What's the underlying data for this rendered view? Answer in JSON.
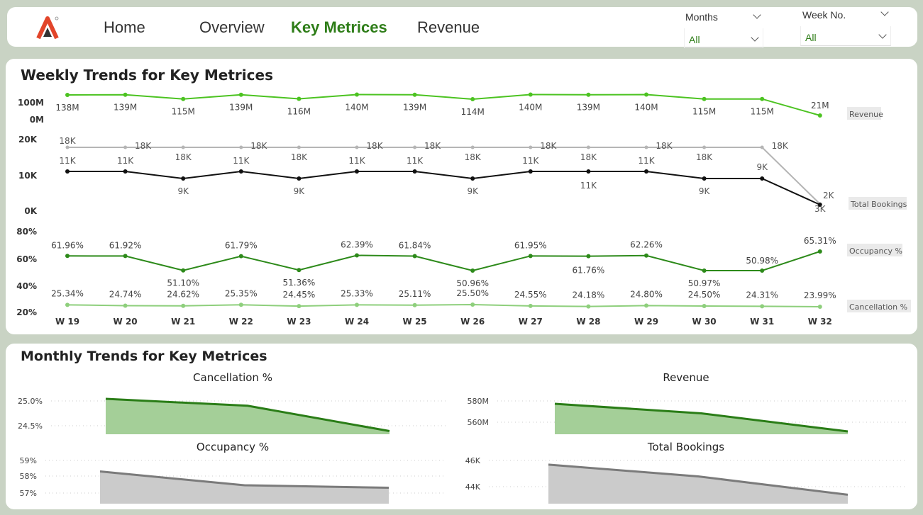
{
  "nav": {
    "items": [
      {
        "label": "Home",
        "active": false
      },
      {
        "label": "Overview",
        "active": false
      },
      {
        "label": "Key Metrices",
        "active": true
      },
      {
        "label": "Revenue",
        "active": false
      }
    ]
  },
  "filters": {
    "months": {
      "label": "Months",
      "value": "All"
    },
    "week": {
      "label": "Week No.",
      "value": "All"
    }
  },
  "weekly": {
    "title": "Weekly Trends for Key Metrices",
    "weeks": [
      "W 19",
      "W 20",
      "W 21",
      "W 22",
      "W 23",
      "W 24",
      "W 25",
      "W 26",
      "W 27",
      "W 28",
      "W 29",
      "W 30",
      "W 31",
      "W 32"
    ],
    "revenue_ticks": [
      "100M",
      "0M"
    ],
    "bookings_ticks": [
      "20K",
      "10K",
      "0K"
    ],
    "pct_ticks": [
      "80%",
      "60%",
      "40%",
      "20%"
    ]
  },
  "monthly": {
    "title": "Monthly Trends for Key Metrices"
  },
  "colors": {
    "accent": "#2e7d18",
    "revenue_line": "#4cc321",
    "occupancy_line": "#2d8a1a",
    "cancellation_line": "#8ecf7c",
    "grey_line": "#b5b5b5",
    "black_line": "#111111"
  },
  "chart_data": [
    {
      "type": "line",
      "name": "weekly-revenue",
      "x": [
        "W 19",
        "W 20",
        "W 21",
        "W 22",
        "W 23",
        "W 24",
        "W 25",
        "W 26",
        "W 27",
        "W 28",
        "W 29",
        "W 30",
        "W 31",
        "W 32"
      ],
      "series": [
        {
          "name": "Revenue",
          "values": [
            138,
            139,
            115,
            139,
            116,
            140,
            139,
            114,
            140,
            139,
            140,
            115,
            115,
            21
          ],
          "labels": [
            "138M",
            "139M",
            "115M",
            "139M",
            "116M",
            "140M",
            "139M",
            "114M",
            "140M",
            "139M",
            "140M",
            "115M",
            "115M",
            "21M"
          ]
        }
      ],
      "yticks": [
        "100M",
        "0M"
      ]
    },
    {
      "type": "line",
      "name": "weekly-bookings",
      "x": [
        "W 19",
        "W 20",
        "W 21",
        "W 22",
        "W 23",
        "W 24",
        "W 25",
        "W 26",
        "W 27",
        "W 28",
        "W 29",
        "W 30",
        "W 31",
        "W 32"
      ],
      "series": [
        {
          "values": [
            18,
            18,
            18,
            18,
            18,
            18,
            18,
            18,
            18,
            18,
            18,
            18,
            18,
            2
          ],
          "labels": [
            "18K",
            "18K",
            "18K",
            "18K",
            "18K",
            "18K",
            "18K",
            "18K",
            "18K",
            "18K",
            "18K",
            "18K",
            "18K",
            "2K"
          ]
        },
        {
          "values": [
            11,
            11,
            9,
            11,
            9,
            11,
            11,
            9,
            11,
            11,
            11,
            9,
            9,
            3
          ],
          "labels": [
            "11K",
            "11K",
            "9K",
            "11K",
            "9K",
            "11K",
            "11K",
            "9K",
            "11K",
            "11K",
            "11K",
            "9K",
            "9K",
            "3K"
          ]
        }
      ],
      "legend": "Total Bookings",
      "yticks": [
        "20K",
        "10K",
        "0K"
      ],
      "ylim": [
        0,
        20
      ]
    },
    {
      "type": "line",
      "name": "weekly-percent",
      "x": [
        "W 19",
        "W 20",
        "W 21",
        "W 22",
        "W 23",
        "W 24",
        "W 25",
        "W 26",
        "W 27",
        "W 28",
        "W 29",
        "W 30",
        "W 31",
        "W 32"
      ],
      "series": [
        {
          "name": "Occupancy %",
          "values": [
            61.96,
            61.92,
            51.1,
            61.79,
            51.36,
            62.39,
            61.84,
            50.96,
            61.95,
            61.76,
            62.26,
            50.97,
            50.98,
            65.31
          ],
          "labels": [
            "61.96%",
            "61.92%",
            "51.10%",
            "61.79%",
            "51.36%",
            "62.39%",
            "61.84%",
            "50.96%",
            "61.95%",
            "61.76%",
            "62.26%",
            "50.97%",
            "50.98%",
            "65.31%"
          ]
        },
        {
          "name": "Cancellation %",
          "values": [
            25.34,
            24.74,
            24.62,
            25.35,
            24.45,
            25.33,
            25.11,
            25.5,
            24.55,
            24.18,
            24.8,
            24.5,
            24.31,
            23.99
          ],
          "labels": [
            "25.34%",
            "24.74%",
            "24.62%",
            "25.35%",
            "24.45%",
            "25.33%",
            "25.11%",
            "25.50%",
            "24.55%",
            "24.18%",
            "24.80%",
            "24.50%",
            "24.31%",
            "23.99%"
          ]
        }
      ],
      "yticks": [
        "80%",
        "60%",
        "40%",
        "20%"
      ],
      "ylim": [
        20,
        80
      ]
    },
    {
      "type": "area",
      "title": "Cancellation %",
      "values": [
        25.1,
        24.96,
        24.45
      ],
      "yticks": [
        "25.0%",
        "24.5%"
      ],
      "ytick_values": [
        25.0,
        24.5
      ],
      "color": "green"
    },
    {
      "type": "area",
      "title": "Revenue",
      "values": [
        580,
        571,
        554
      ],
      "yticks": [
        "580M",
        "560M"
      ],
      "ytick_values": [
        580,
        560
      ],
      "color": "green"
    },
    {
      "type": "area",
      "title": "Occupancy %",
      "values": [
        58.5,
        57.65,
        57.5
      ],
      "yticks": [
        "59%",
        "58%",
        "57%"
      ],
      "ytick_values": [
        59,
        58,
        57
      ],
      "color": "grey"
    },
    {
      "type": "area",
      "title": "Total Bookings",
      "values": [
        45.9,
        45.0,
        43.6
      ],
      "yticks": [
        "46K",
        "44K"
      ],
      "ytick_values": [
        46,
        44
      ],
      "color": "grey"
    }
  ]
}
